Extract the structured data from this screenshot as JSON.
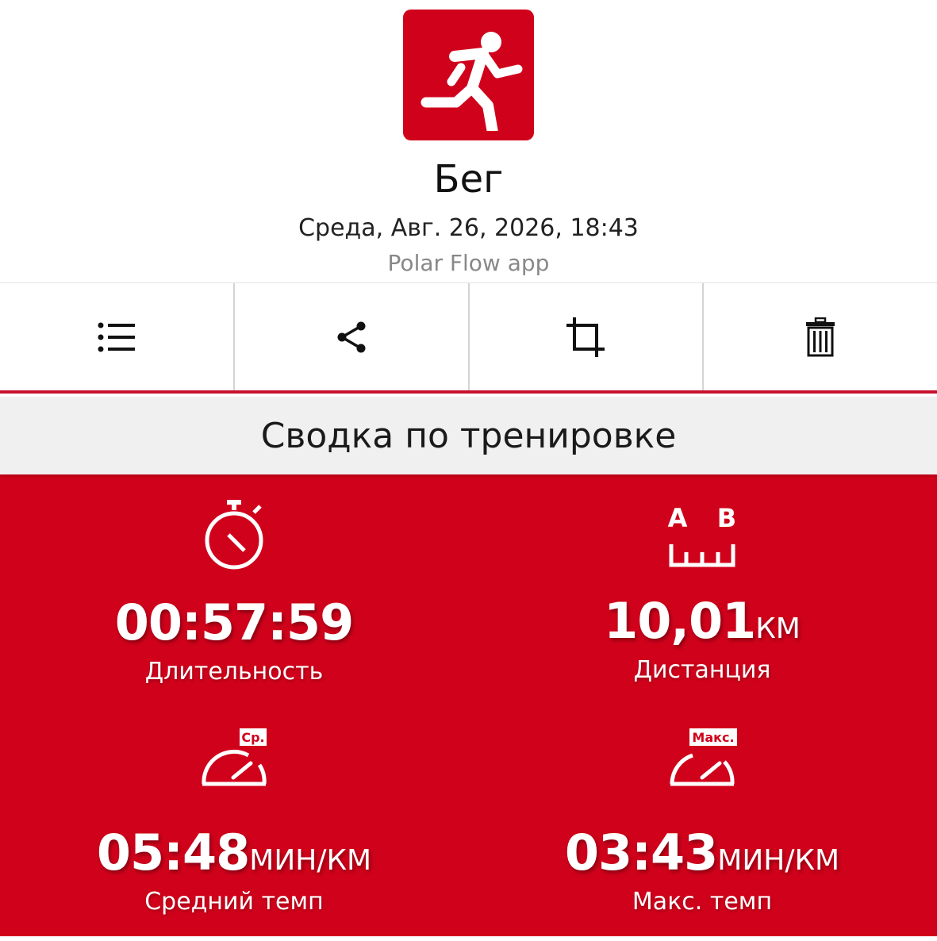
{
  "header": {
    "sport_icon": "running-person-icon",
    "sport_name": "Бег",
    "date_time": "Среда, Авг. 26, 2026, 18:43",
    "source": "Polar Flow app"
  },
  "toolbar": {
    "items": [
      {
        "icon": "list-icon"
      },
      {
        "icon": "share-icon"
      },
      {
        "icon": "crop-icon"
      },
      {
        "icon": "trash-icon"
      }
    ]
  },
  "summary": {
    "title": "Сводка по тренировке",
    "duration": {
      "value": "00:57:59",
      "unit": "",
      "label": "Длительность",
      "icon": "stopwatch-icon"
    },
    "distance": {
      "value": "10,01",
      "unit": "КМ",
      "label": "Дистанция",
      "icon": "distance-ab-icon",
      "icon_text_a": "A",
      "icon_text_b": "B"
    },
    "avg_pace": {
      "value": "05:48",
      "unit": "МИН/КМ",
      "label": "Средний темп",
      "icon": "speedometer-avg-icon",
      "badge": "Ср."
    },
    "max_pace": {
      "value": "03:43",
      "unit": "МИН/КМ",
      "label": "Макс. темп",
      "icon": "speedometer-max-icon",
      "badge": "Макс."
    }
  },
  "colors": {
    "accent": "#d0021b",
    "section_bg": "#f0f0f0",
    "text_secondary": "#888888"
  }
}
